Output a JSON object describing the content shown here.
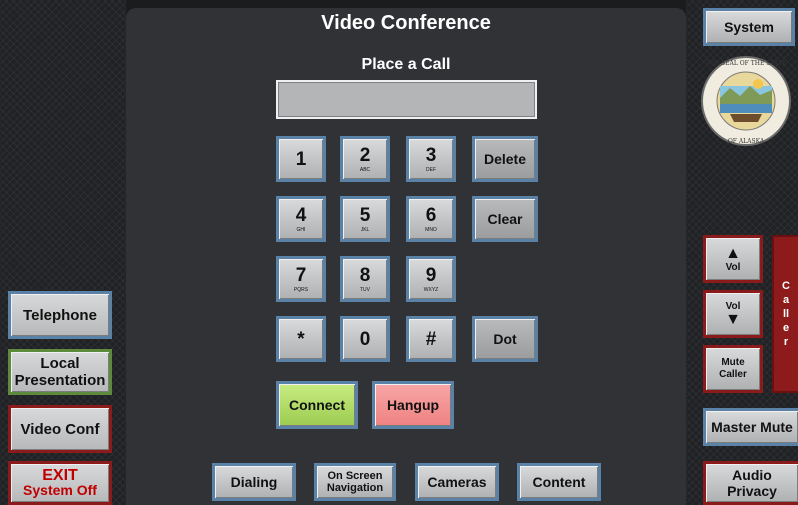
{
  "header": {
    "title": "Video Conference",
    "subtitle": "Place a Call"
  },
  "dial_input": {
    "value": ""
  },
  "keypad": {
    "k1": {
      "digit": "1",
      "letters": ""
    },
    "k2": {
      "digit": "2",
      "letters": "ABC"
    },
    "k3": {
      "digit": "3",
      "letters": "DEF"
    },
    "k4": {
      "digit": "4",
      "letters": "GHI"
    },
    "k5": {
      "digit": "5",
      "letters": "JKL"
    },
    "k6": {
      "digit": "6",
      "letters": "MNO"
    },
    "k7": {
      "digit": "7",
      "letters": "PQRS"
    },
    "k8": {
      "digit": "8",
      "letters": "TUV"
    },
    "k9": {
      "digit": "9",
      "letters": "WXYZ"
    },
    "kstar": {
      "digit": "*"
    },
    "k0": {
      "digit": "0"
    },
    "khash": {
      "digit": "#"
    },
    "delete": "Delete",
    "clear": "Clear",
    "dot": "Dot"
  },
  "call": {
    "connect": "Connect",
    "hangup": "Hangup"
  },
  "bottom_tabs": {
    "dialing": "Dialing",
    "on_screen_1": "On Screen",
    "on_screen_2": "Navigation",
    "cameras": "Cameras",
    "content": "Content"
  },
  "left_nav": {
    "telephone": "Telephone",
    "local_1": "Local",
    "local_2": "Presentation",
    "video_conf": "Video Conf",
    "exit_1": "EXIT",
    "exit_2": "System Off"
  },
  "right_nav": {
    "system": "System",
    "vol_up": "Vol",
    "vol_down": "Vol",
    "mute_1": "Mute",
    "mute_2": "Caller",
    "caller_tab": "Caller",
    "master_mute": "Master Mute",
    "audio_1": "Audio",
    "audio_2": "Privacy"
  },
  "seal": {
    "text_top": "THE SEAL OF THE STATE",
    "text_bottom": "OF ALASKA"
  },
  "colors": {
    "connect": "#b8e070",
    "hangup": "#f49090",
    "exit_text": "#c00000",
    "red_border": "#8b1a1a",
    "green_border": "#5d8a3c",
    "blue_border": "#5a82a6",
    "caller_tab": "#8e1b1b"
  }
}
